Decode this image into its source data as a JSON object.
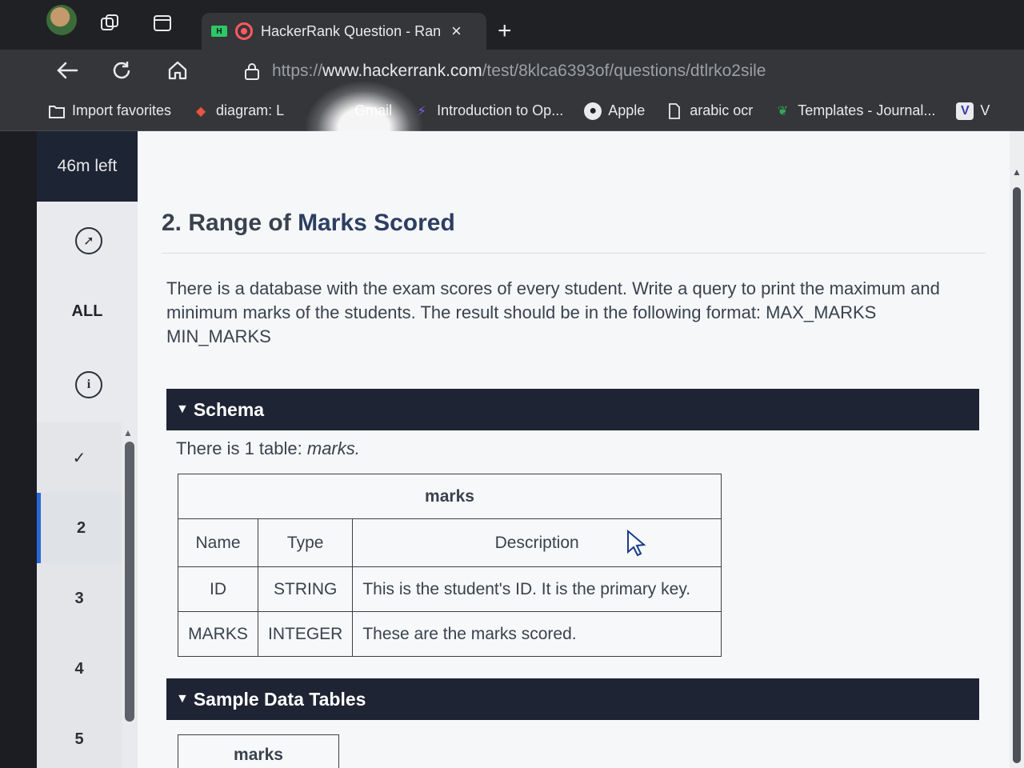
{
  "browser": {
    "tab": {
      "title": "HackerRank Question - Ran",
      "close_icon": "×",
      "hr_badge": "H"
    },
    "new_tab_icon": "+",
    "url": {
      "protocol": "https://",
      "domain": "www.hackerrank.com",
      "path": "/test/8klca6393of/questions/dtlrko2sile"
    },
    "bookmarks": [
      {
        "label": "Import favorites",
        "icon": "import-icon"
      },
      {
        "label": "diagram: L",
        "icon": "diagram-icon"
      },
      {
        "label": "Gmail",
        "icon": "gmail-icon"
      },
      {
        "label": "Introduction to Op...",
        "icon": "intro-icon"
      },
      {
        "label": "Apple",
        "icon": "apple-icon"
      },
      {
        "label": "arabic ocr",
        "icon": "page-icon"
      },
      {
        "label": "Templates - Journal...",
        "icon": "templates-icon"
      },
      {
        "label": "V",
        "icon": "v-icon"
      }
    ]
  },
  "sidebar": {
    "timer": "46m left",
    "all_label": "ALL",
    "questions": [
      {
        "label": "✓",
        "status": "done"
      },
      {
        "label": "2",
        "status": "active"
      },
      {
        "label": "3",
        "status": "pending"
      },
      {
        "label": "4",
        "status": "pending"
      },
      {
        "label": "5",
        "status": "pending"
      }
    ]
  },
  "question": {
    "number": "2.",
    "title_part1": "Range of",
    "title_part2": "Marks Scored",
    "description": "There is a database with the exam scores of every student. Write a query to print the maximum and minimum marks of the students. The result should be in the following format: MAX_MARKS MIN_MARKS",
    "schema": {
      "heading": "Schema",
      "note_prefix": "There is 1 table:",
      "note_table": "marks.",
      "table_name": "marks",
      "columns": [
        "Name",
        "Type",
        "Description"
      ],
      "rows": [
        [
          "ID",
          "STRING",
          "This is the student's ID. It is the primary key."
        ],
        [
          "MARKS",
          "INTEGER",
          "These are the marks scored."
        ]
      ]
    },
    "sample": {
      "heading": "Sample Data Tables",
      "table_name": "marks"
    }
  },
  "colors": {
    "dark_bar": "#1e2433",
    "active_accent": "#2a67d6",
    "text": "#39424e"
  }
}
